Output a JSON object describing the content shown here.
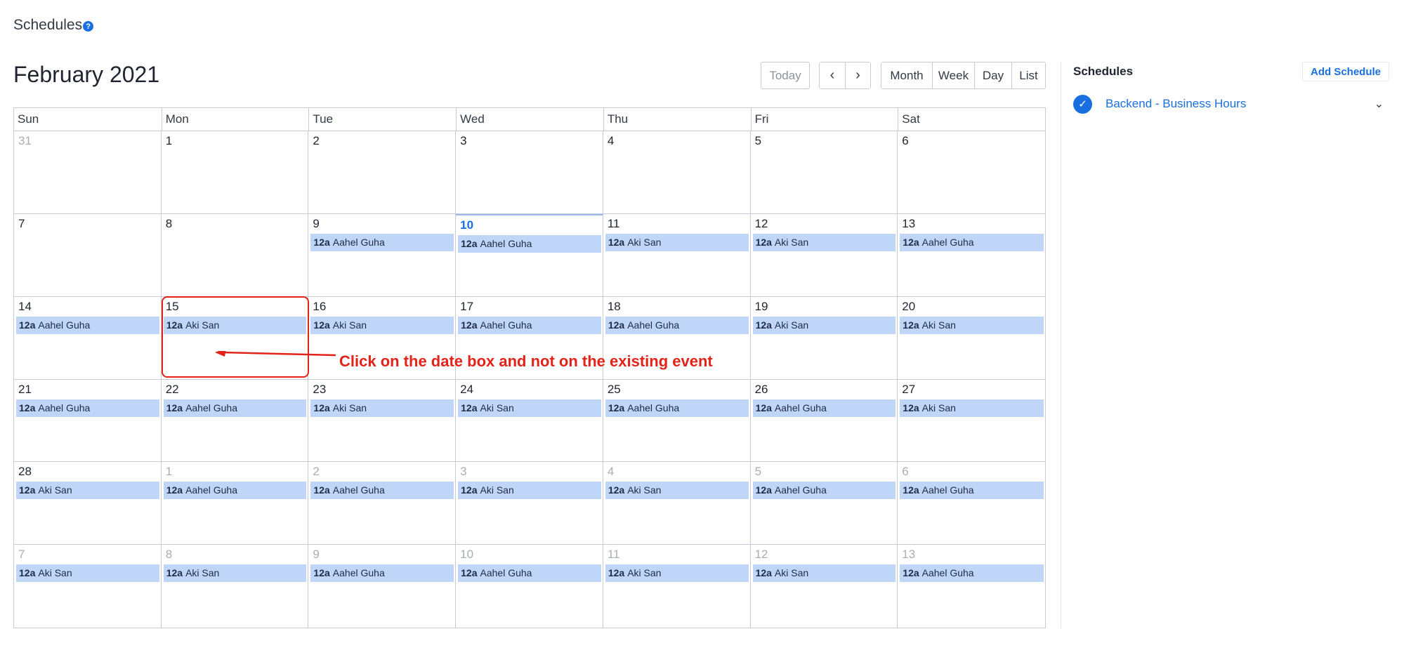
{
  "page": {
    "heading": "Schedules",
    "help_icon": "?"
  },
  "calendar": {
    "title": "February 2021",
    "today_label": "Today",
    "prev_label": "‹",
    "next_label": "›",
    "views": {
      "month": "Month",
      "week": "Week",
      "day": "Day",
      "list": "List"
    },
    "weekdays": [
      "Sun",
      "Mon",
      "Tue",
      "Wed",
      "Thu",
      "Fri",
      "Sat"
    ],
    "cells": [
      {
        "day": "31",
        "other": true,
        "event": null
      },
      {
        "day": "1",
        "other": false,
        "event": null
      },
      {
        "day": "2",
        "other": false,
        "event": null
      },
      {
        "day": "3",
        "other": false,
        "event": null
      },
      {
        "day": "4",
        "other": false,
        "event": null
      },
      {
        "day": "5",
        "other": false,
        "event": null
      },
      {
        "day": "6",
        "other": false,
        "event": null
      },
      {
        "day": "7",
        "other": false,
        "event": null
      },
      {
        "day": "8",
        "other": false,
        "event": null
      },
      {
        "day": "9",
        "other": false,
        "event": {
          "time": "12a",
          "name": "Aahel Guha"
        }
      },
      {
        "day": "10",
        "other": false,
        "today": true,
        "event": {
          "time": "12a",
          "name": "Aahel Guha"
        }
      },
      {
        "day": "11",
        "other": false,
        "event": {
          "time": "12a",
          "name": "Aki San"
        }
      },
      {
        "day": "12",
        "other": false,
        "event": {
          "time": "12a",
          "name": "Aki San"
        }
      },
      {
        "day": "13",
        "other": false,
        "event": {
          "time": "12a",
          "name": "Aahel Guha"
        }
      },
      {
        "day": "14",
        "other": false,
        "event": {
          "time": "12a",
          "name": "Aahel Guha"
        }
      },
      {
        "day": "15",
        "other": false,
        "event": {
          "time": "12a",
          "name": "Aki San"
        }
      },
      {
        "day": "16",
        "other": false,
        "event": {
          "time": "12a",
          "name": "Aki San"
        }
      },
      {
        "day": "17",
        "other": false,
        "event": {
          "time": "12a",
          "name": "Aahel Guha"
        }
      },
      {
        "day": "18",
        "other": false,
        "event": {
          "time": "12a",
          "name": "Aahel Guha"
        }
      },
      {
        "day": "19",
        "other": false,
        "event": {
          "time": "12a",
          "name": "Aki San"
        }
      },
      {
        "day": "20",
        "other": false,
        "event": {
          "time": "12a",
          "name": "Aki San"
        }
      },
      {
        "day": "21",
        "other": false,
        "event": {
          "time": "12a",
          "name": "Aahel Guha"
        }
      },
      {
        "day": "22",
        "other": false,
        "event": {
          "time": "12a",
          "name": "Aahel Guha"
        }
      },
      {
        "day": "23",
        "other": false,
        "event": {
          "time": "12a",
          "name": "Aki San"
        }
      },
      {
        "day": "24",
        "other": false,
        "event": {
          "time": "12a",
          "name": "Aki San"
        }
      },
      {
        "day": "25",
        "other": false,
        "event": {
          "time": "12a",
          "name": "Aahel Guha"
        }
      },
      {
        "day": "26",
        "other": false,
        "event": {
          "time": "12a",
          "name": "Aahel Guha"
        }
      },
      {
        "day": "27",
        "other": false,
        "event": {
          "time": "12a",
          "name": "Aki San"
        }
      },
      {
        "day": "28",
        "other": false,
        "event": {
          "time": "12a",
          "name": "Aki San"
        }
      },
      {
        "day": "1",
        "other": true,
        "event": {
          "time": "12a",
          "name": "Aahel Guha"
        }
      },
      {
        "day": "2",
        "other": true,
        "event": {
          "time": "12a",
          "name": "Aahel Guha"
        }
      },
      {
        "day": "3",
        "other": true,
        "event": {
          "time": "12a",
          "name": "Aki San"
        }
      },
      {
        "day": "4",
        "other": true,
        "event": {
          "time": "12a",
          "name": "Aki San"
        }
      },
      {
        "day": "5",
        "other": true,
        "event": {
          "time": "12a",
          "name": "Aahel Guha"
        }
      },
      {
        "day": "6",
        "other": true,
        "event": {
          "time": "12a",
          "name": "Aahel Guha"
        }
      },
      {
        "day": "7",
        "other": true,
        "event": {
          "time": "12a",
          "name": "Aki San"
        }
      },
      {
        "day": "8",
        "other": true,
        "event": {
          "time": "12a",
          "name": "Aki San"
        }
      },
      {
        "day": "9",
        "other": true,
        "event": {
          "time": "12a",
          "name": "Aahel Guha"
        }
      },
      {
        "day": "10",
        "other": true,
        "event": {
          "time": "12a",
          "name": "Aahel Guha"
        }
      },
      {
        "day": "11",
        "other": true,
        "event": {
          "time": "12a",
          "name": "Aki San"
        }
      },
      {
        "day": "12",
        "other": true,
        "event": {
          "time": "12a",
          "name": "Aki San"
        }
      },
      {
        "day": "13",
        "other": true,
        "event": {
          "time": "12a",
          "name": "Aahel Guha"
        }
      }
    ]
  },
  "annotation": {
    "text": "Click on the date box and not on the existing event",
    "color": "#e2231a"
  },
  "sidebar": {
    "title": "Schedules",
    "add_label": "Add Schedule",
    "schedules": [
      {
        "name": "Backend - Business Hours",
        "checked": true
      }
    ]
  },
  "colors": {
    "accent": "#1a6fe0",
    "event_bg": "#c0d6f9",
    "grid": "#c6cad3"
  },
  "icons": {
    "help": "question-circle-icon",
    "check": "check-circle-icon",
    "chevron": "chevron-down-icon"
  }
}
